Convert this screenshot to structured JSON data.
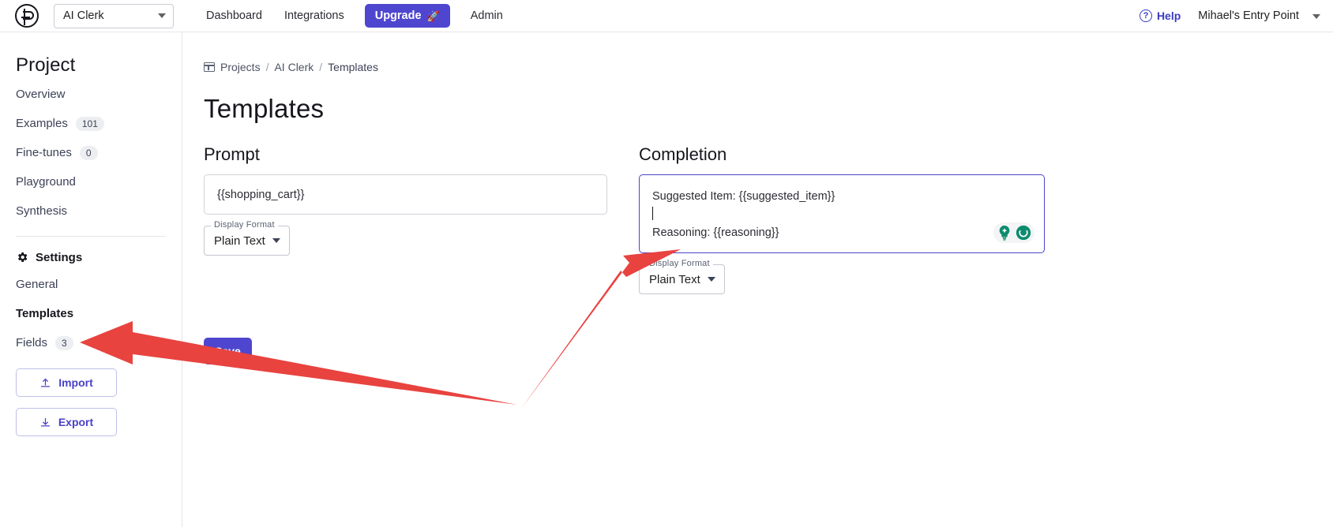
{
  "header": {
    "logo_icon": "fp-logo-icon",
    "project_selector": {
      "value": "AI Clerk",
      "caret_icon": "chevron-down-icon"
    },
    "nav": [
      {
        "label": "Dashboard"
      },
      {
        "label": "Integrations"
      },
      {
        "label": "Admin"
      }
    ],
    "upgrade": {
      "label": "Upgrade",
      "icon": "rocket-icon",
      "glyph": "🚀",
      "color": "#4f46cf"
    },
    "help": {
      "label": "Help",
      "icon": "question-circle-icon",
      "glyph": "?",
      "color": "#3b3bc4"
    },
    "account": {
      "label": "Mihael's Entry Point",
      "caret_icon": "chevron-down-icon"
    }
  },
  "sidebar": {
    "title": "Project",
    "items": [
      {
        "label": "Overview",
        "badge": null,
        "active": false
      },
      {
        "label": "Examples",
        "badge": "101",
        "active": false
      },
      {
        "label": "Fine-tunes",
        "badge": "0",
        "active": false
      },
      {
        "label": "Playground",
        "badge": null,
        "active": false
      },
      {
        "label": "Synthesis",
        "badge": null,
        "active": false
      }
    ],
    "settings_heading": {
      "label": "Settings",
      "icon": "gear-icon"
    },
    "settings_items": [
      {
        "label": "General",
        "badge": null,
        "active": false
      },
      {
        "label": "Templates",
        "badge": null,
        "active": true
      },
      {
        "label": "Fields",
        "badge": "3",
        "active": false
      }
    ],
    "buttons": [
      {
        "label": "Import",
        "icon": "upload-icon"
      },
      {
        "label": "Export",
        "icon": "download-icon"
      }
    ]
  },
  "breadcrumb": {
    "icon": "projects-icon",
    "items": [
      "Projects",
      "AI Clerk",
      "Templates"
    ],
    "separator": "/"
  },
  "page": {
    "title": "Templates",
    "prompt": {
      "heading": "Prompt",
      "value": "{{shopping_cart}}",
      "display_format": {
        "legend": "Display Format",
        "value": "Plain Text",
        "caret_icon": "chevron-down-icon"
      }
    },
    "completion": {
      "heading": "Completion",
      "line1": "Suggested Item: {{suggested_item}}",
      "line2": "",
      "line3": "Reasoning: {{reasoning}}",
      "focused": true,
      "assistant_icons": [
        {
          "name": "lightbulb-icon",
          "color": "#0d8b6e"
        },
        {
          "name": "grammarly-circle-icon",
          "color": "#0d8b6e"
        }
      ],
      "display_format": {
        "legend": "Display Format",
        "value": "Plain Text",
        "caret_icon": "chevron-down-icon"
      }
    },
    "save_button": {
      "label": "Save",
      "color": "#4f46cf"
    }
  },
  "annotations": {
    "arrow_color": "#e8433f",
    "arrows": [
      {
        "name": "arrow-to-templates",
        "points_to": "Templates"
      },
      {
        "name": "arrow-to-completion",
        "points_to": "Completion"
      }
    ]
  }
}
